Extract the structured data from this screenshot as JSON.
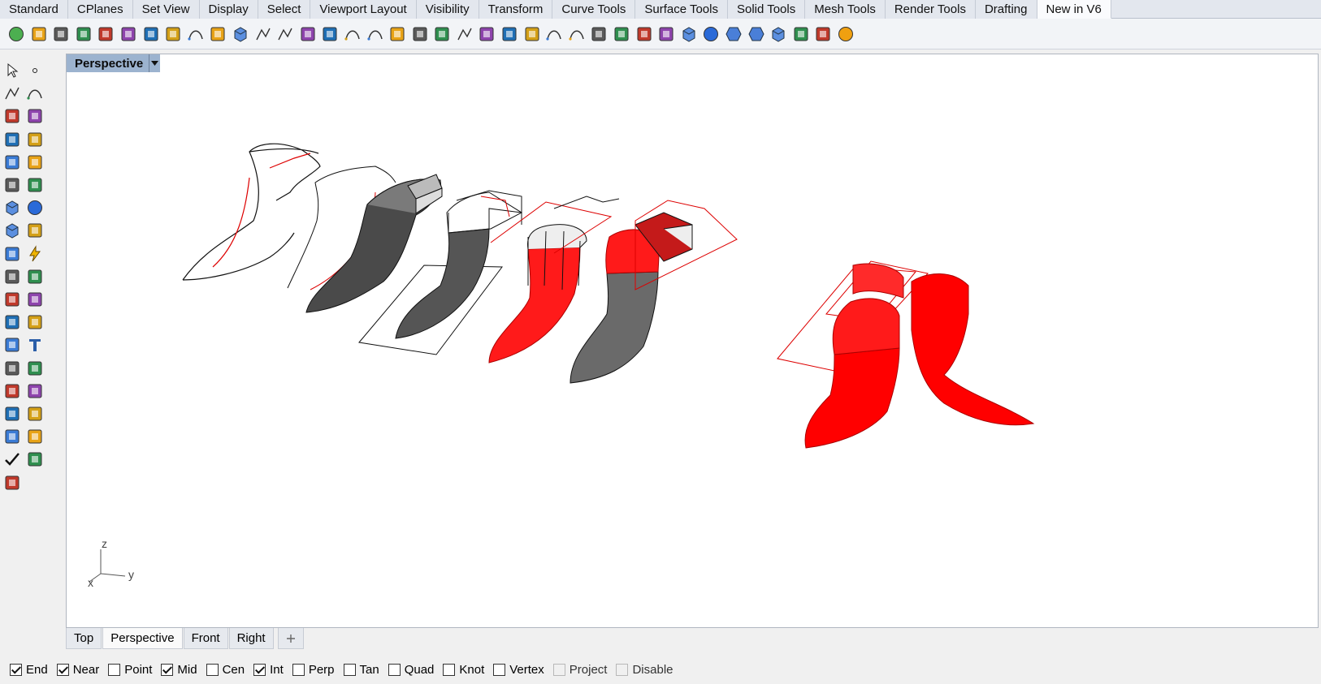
{
  "tabs": [
    {
      "label": "Standard",
      "active": false
    },
    {
      "label": "CPlanes",
      "active": false
    },
    {
      "label": "Set View",
      "active": false
    },
    {
      "label": "Display",
      "active": false
    },
    {
      "label": "Select",
      "active": false
    },
    {
      "label": "Viewport Layout",
      "active": false
    },
    {
      "label": "Visibility",
      "active": false
    },
    {
      "label": "Transform",
      "active": false
    },
    {
      "label": "Curve Tools",
      "active": false
    },
    {
      "label": "Surface Tools",
      "active": false
    },
    {
      "label": "Solid Tools",
      "active": false
    },
    {
      "label": "Mesh Tools",
      "active": false
    },
    {
      "label": "Render Tools",
      "active": false
    },
    {
      "label": "Drafting",
      "active": false
    },
    {
      "label": "New in V6",
      "active": true
    }
  ],
  "toolbar_icons": [
    "globe-icon",
    "lamp-icon",
    "clipboard-icon",
    "grid-color-icon",
    "lasso-icon",
    "key-icon",
    "pin-icon",
    "pins-icon",
    "curve-icon",
    "dot-grid-icon",
    "cube-v-icon",
    "polyline-icon",
    "pen-icon",
    "ruler-icon",
    "gauge-icon",
    "arc-icon",
    "dashed-curve-icon",
    "list-icon",
    "bar-chart-icon",
    "panel-icon",
    "line-icon",
    "hatch-icon",
    "monitor-icon",
    "arrows-icon",
    "rainbow-icon",
    "zoom-curve-icon",
    "zoom-icon",
    "target-icon",
    "frame-icon",
    "steps-icon",
    "box-icon",
    "blue-disc-icon",
    "hexagon-icon",
    "hexagon-split-icon",
    "cylinder-icon",
    "blade-icon",
    "gear-frame-icon",
    "orange-sphere-icon"
  ],
  "left_tools": [
    "select-arrow-icon",
    "point-icon",
    "polyline-tool-icon",
    "curve-point-icon",
    "circle-tool-icon",
    "ellipse-tool-icon",
    "triangle-tool-icon",
    "rectangle-tool-icon",
    "polygon-tool-icon",
    "fillet-tool-icon",
    "surface-edge-icon",
    "sweep-icon",
    "box-solid-icon",
    "sphere-solid-icon",
    "cylinder-solid-icon",
    "surface-patch-icon",
    "gear-tool-icon",
    "lightning-icon",
    "explode-icon",
    "trim-icon",
    "split-icon",
    "boolean-icon",
    "group-icon",
    "offset-icon",
    "array-icon",
    "text-tool-icon",
    "move-icon",
    "copy-array-icon",
    "dimension-icon",
    "block-icon",
    "layout-icon",
    "grid-array-icon",
    "gumball-icon",
    "clip-icon",
    "check-icon",
    "shade-icon",
    "paint-bucket-icon"
  ],
  "viewport": {
    "title": "Perspective",
    "axes": {
      "z": "z",
      "y": "y",
      "x": "x"
    }
  },
  "viewport_tabs": [
    {
      "label": "Top",
      "active": false
    },
    {
      "label": "Perspective",
      "active": true
    },
    {
      "label": "Front",
      "active": false
    },
    {
      "label": "Right",
      "active": false
    }
  ],
  "osnaps": [
    {
      "label": "End",
      "checked": true,
      "disabled": false
    },
    {
      "label": "Near",
      "checked": true,
      "disabled": false
    },
    {
      "label": "Point",
      "checked": false,
      "disabled": false
    },
    {
      "label": "Mid",
      "checked": true,
      "disabled": false
    },
    {
      "label": "Cen",
      "checked": false,
      "disabled": false
    },
    {
      "label": "Int",
      "checked": true,
      "disabled": false
    },
    {
      "label": "Perp",
      "checked": false,
      "disabled": false
    },
    {
      "label": "Tan",
      "checked": false,
      "disabled": false
    },
    {
      "label": "Quad",
      "checked": false,
      "disabled": false
    },
    {
      "label": "Knot",
      "checked": false,
      "disabled": false
    },
    {
      "label": "Vertex",
      "checked": false,
      "disabled": false
    },
    {
      "label": "Project",
      "checked": false,
      "disabled": true
    },
    {
      "label": "Disable",
      "checked": false,
      "disabled": true
    }
  ],
  "colors": {
    "accent_red": "#ff0000",
    "viewport_title_bg": "#9cb3cf"
  }
}
